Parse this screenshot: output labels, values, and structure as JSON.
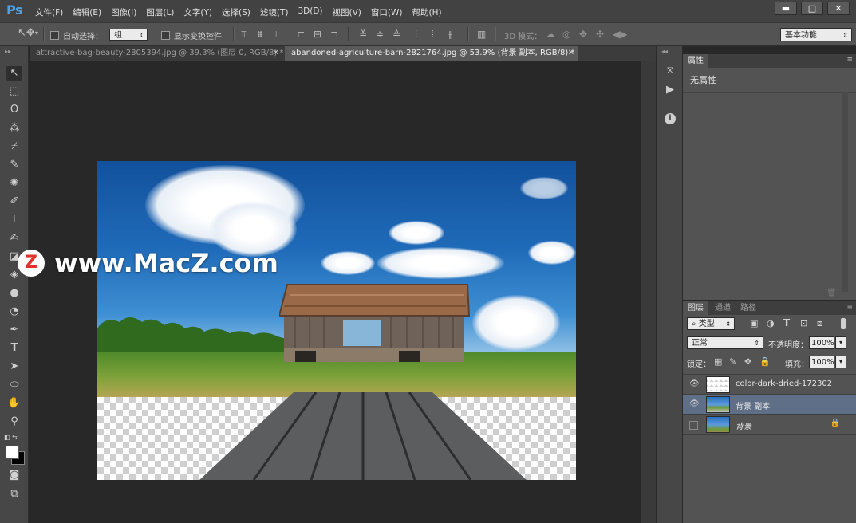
{
  "app": {
    "logo": "Ps",
    "menu": [
      "文件(F)",
      "编辑(E)",
      "图像(I)",
      "图层(L)",
      "文字(Y)",
      "选择(S)",
      "滤镜(T)",
      "3D(D)",
      "视图(V)",
      "窗口(W)",
      "帮助(H)"
    ],
    "window_buttons": {
      "minimize": "▬",
      "maximize": "□",
      "close": "✕"
    }
  },
  "options_bar": {
    "auto_select_label": "自动选择：",
    "auto_select_value": "组",
    "show_transform_label": "显示变换控件",
    "mode_3d_label": "3D 模式：",
    "workspace_value": "基本功能"
  },
  "tabs": [
    {
      "label": "attractive-bag-beauty-2805394.jpg @ 39.3% (图层 0, RGB/8) *",
      "close": "✕",
      "active": false
    },
    {
      "label": "abandoned-agriculture-barn-2821764.jpg @ 53.9% (背景 副本, RGB/8) *",
      "close": "✕",
      "active": true
    }
  ],
  "watermark": {
    "badge": "Z",
    "text": "www.MacZ.com"
  },
  "properties_panel": {
    "tab": "属性",
    "content": "无属性"
  },
  "layers_panel": {
    "tabs": [
      "图层",
      "通道",
      "路径"
    ],
    "filter_value": "类型",
    "blend_mode": "正常",
    "opacity_label": "不透明度：",
    "opacity_value": "100%",
    "lock_label": "锁定：",
    "fill_label": "填充：",
    "fill_value": "100%",
    "layers": [
      {
        "name": "color-dark-dried-172302",
        "visible": true,
        "selected": false,
        "locked": false
      },
      {
        "name": "背景 副本",
        "visible": true,
        "selected": true,
        "locked": false
      },
      {
        "name": "背景",
        "visible": false,
        "selected": false,
        "locked": true
      }
    ]
  },
  "colors": {
    "accent_blue": "#4fa3e6",
    "selected_layer": "#5f6f88",
    "watermark_red": "#e0312b"
  }
}
